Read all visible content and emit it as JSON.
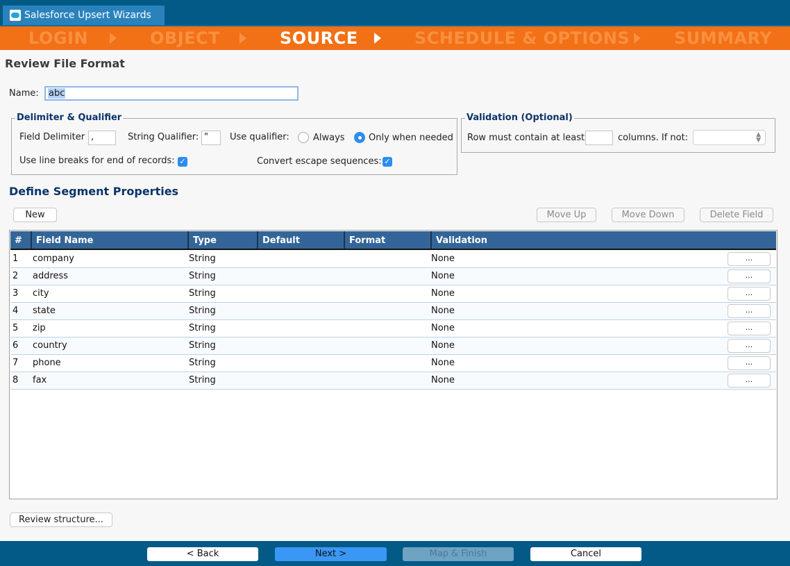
{
  "window": {
    "tab_title": "Salesforce Upsert Wizards",
    "tab_icon": "salesforce-cloud-icon"
  },
  "steps": [
    {
      "label": "LOGIN",
      "active": false
    },
    {
      "label": "OBJECT",
      "active": false
    },
    {
      "label": "SOURCE",
      "active": true
    },
    {
      "label": "SCHEDULE & OPTIONS",
      "active": false
    },
    {
      "label": "SUMMARY",
      "active": false
    }
  ],
  "page": {
    "title": "Review File Format"
  },
  "name_field": {
    "label": "Name:",
    "value": "abc"
  },
  "delimiter": {
    "legend": "Delimiter & Qualifier",
    "field_delimiter_label": "Field Delimiter",
    "field_delimiter_value": ",",
    "string_qualifier_label": "String Qualifier:",
    "string_qualifier_value": "\"",
    "use_qualifier_label": "Use qualifier:",
    "options": [
      {
        "label": "Always",
        "selected": false
      },
      {
        "label": "Only when needed",
        "selected": true
      }
    ],
    "line_breaks_label": "Use line breaks for end of records:",
    "line_breaks_checked": true,
    "escape_label": "Convert escape sequences:",
    "escape_checked": true
  },
  "validation": {
    "legend": "Validation (Optional)",
    "row_label": "Row must contain at least",
    "columns_value": "",
    "if_not_label": "columns. If not:",
    "if_not_selected": ""
  },
  "segment": {
    "title": "Define Segment Properties",
    "new_label": "New",
    "move_up_label": "Move Up",
    "move_down_label": "Move Down",
    "delete_label": "Delete Field",
    "columns": [
      "#",
      "Field Name",
      "Type",
      "Default",
      "Format",
      "Validation"
    ],
    "rows": [
      {
        "num": "1",
        "name": "company",
        "type": "String",
        "default": "",
        "format": "",
        "validation": "None",
        "action": "..."
      },
      {
        "num": "2",
        "name": "address",
        "type": "String",
        "default": "",
        "format": "",
        "validation": "None",
        "action": "..."
      },
      {
        "num": "3",
        "name": "city",
        "type": "String",
        "default": "",
        "format": "",
        "validation": "None",
        "action": "..."
      },
      {
        "num": "4",
        "name": "state",
        "type": "String",
        "default": "",
        "format": "",
        "validation": "None",
        "action": "..."
      },
      {
        "num": "5",
        "name": "zip",
        "type": "String",
        "default": "",
        "format": "",
        "validation": "None",
        "action": "..."
      },
      {
        "num": "6",
        "name": "country",
        "type": "String",
        "default": "",
        "format": "",
        "validation": "None",
        "action": "..."
      },
      {
        "num": "7",
        "name": "phone",
        "type": "String",
        "default": "",
        "format": "",
        "validation": "None",
        "action": "..."
      },
      {
        "num": "8",
        "name": "fax",
        "type": "String",
        "default": "",
        "format": "",
        "validation": "None",
        "action": "..."
      }
    ],
    "review_label": "Review structure..."
  },
  "footer": {
    "back": "< Back",
    "next": "Next >",
    "map_finish": "Map & Finish",
    "cancel": "Cancel"
  },
  "colors": {
    "brand_blue": "#035a87",
    "steps_orange": "#f27016",
    "header_blue": "#336598",
    "primary_button": "#3b97f5"
  }
}
